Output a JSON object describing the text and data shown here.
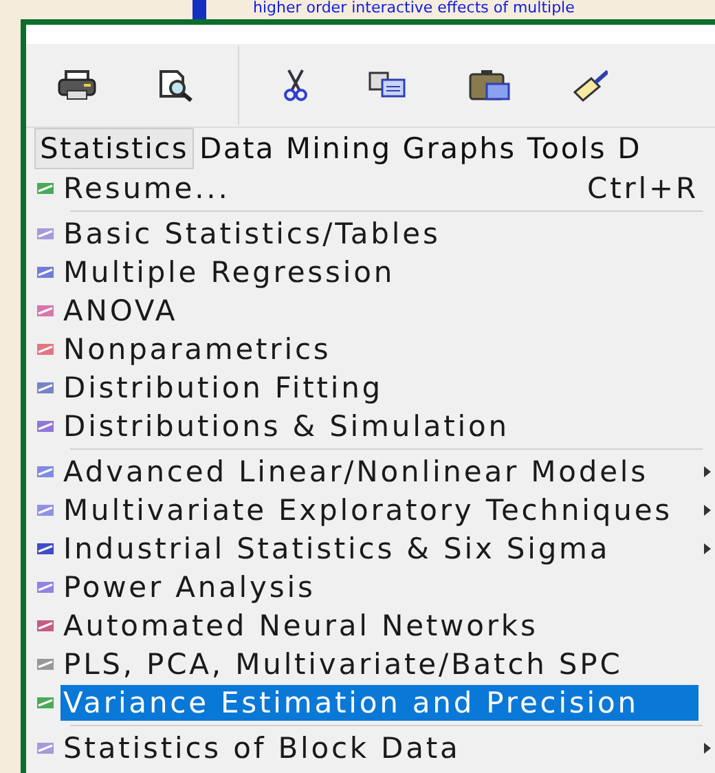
{
  "background_text": "higher order interactive effects of multiple",
  "toolbar": [
    {
      "kind": "print"
    },
    {
      "kind": "preview"
    },
    {
      "kind": "separator"
    },
    {
      "kind": "cut"
    },
    {
      "kind": "copy"
    },
    {
      "kind": "paste"
    },
    {
      "kind": "brush"
    }
  ],
  "menubar": [
    {
      "label": "Statistics",
      "selected": true
    },
    {
      "label": "Data Mining",
      "selected": false
    },
    {
      "label": "Graphs",
      "selected": false
    },
    {
      "label": "Tools",
      "selected": false
    },
    {
      "label": "D",
      "selected": false
    }
  ],
  "menu": [
    {
      "kind": "item",
      "label": "Resume...",
      "shortcut": "Ctrl+R",
      "selected": false,
      "submenu": false
    },
    {
      "kind": "separator"
    },
    {
      "kind": "item",
      "label": "Basic Statistics/Tables",
      "selected": false,
      "submenu": false
    },
    {
      "kind": "item",
      "label": "Multiple Regression",
      "selected": false,
      "submenu": false
    },
    {
      "kind": "item",
      "label": "ANOVA",
      "selected": false,
      "submenu": false
    },
    {
      "kind": "item",
      "label": "Nonparametrics",
      "selected": false,
      "submenu": false
    },
    {
      "kind": "item",
      "label": "Distribution Fitting",
      "selected": false,
      "submenu": false
    },
    {
      "kind": "item",
      "label": "Distributions & Simulation",
      "selected": false,
      "submenu": false
    },
    {
      "kind": "separator"
    },
    {
      "kind": "item",
      "label": "Advanced Linear/Nonlinear Models",
      "selected": false,
      "submenu": true
    },
    {
      "kind": "item",
      "label": "Multivariate Exploratory Techniques",
      "selected": false,
      "submenu": true
    },
    {
      "kind": "item",
      "label": "Industrial Statistics & Six Sigma",
      "selected": false,
      "submenu": true
    },
    {
      "kind": "item",
      "label": "Power Analysis",
      "selected": false,
      "submenu": false
    },
    {
      "kind": "item",
      "label": "Automated Neural Networks",
      "selected": false,
      "submenu": false
    },
    {
      "kind": "item",
      "label": "PLS, PCA, Multivariate/Batch SPC",
      "selected": false,
      "submenu": false
    },
    {
      "kind": "item",
      "label": "Variance Estimation and Precision",
      "selected": true,
      "submenu": false
    },
    {
      "kind": "separator"
    },
    {
      "kind": "item",
      "label": "Statistics of Block Data",
      "selected": false,
      "submenu": true
    }
  ]
}
